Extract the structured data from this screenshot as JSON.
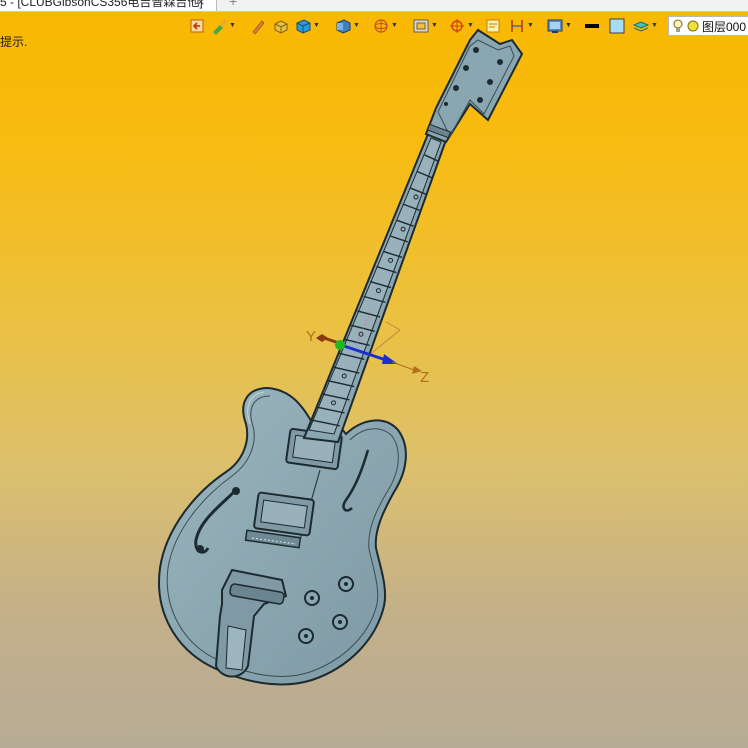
{
  "document_tab": {
    "title": "5 - [CLUBGibsonCS356电吉普森吉他]",
    "close_glyph": "×",
    "new_tab_glyph": "+"
  },
  "prompt": {
    "hint_text": "提示."
  },
  "toolbar": {
    "icons": [
      "exit-sketch-icon",
      "paint-brush-icon",
      "pencil-icon",
      "box-shaded-icon",
      "cube-icon",
      "view-orientation-icon",
      "wireframe-sphere-icon",
      "frame-view-icon",
      "origin-crosshair-icon",
      "note-icon",
      "dimension-icon",
      "display-settings-icon",
      "line-color-icon",
      "fill-color-icon",
      "layer-stack-icon",
      "lightbulb-icon",
      "layer-status-icon"
    ],
    "layer_field": "图层000"
  },
  "viewport": {
    "background_top": "#f9b800",
    "background_bottom": "#b6ab95",
    "model_fill": "#8aa6b0",
    "model_edge": "#1d2a30",
    "triad": {
      "y_label": "Y",
      "z_label": "Z",
      "y_color": "#8a3a10",
      "z_color": "#1a2fd0",
      "x_color": "#22b822"
    }
  }
}
